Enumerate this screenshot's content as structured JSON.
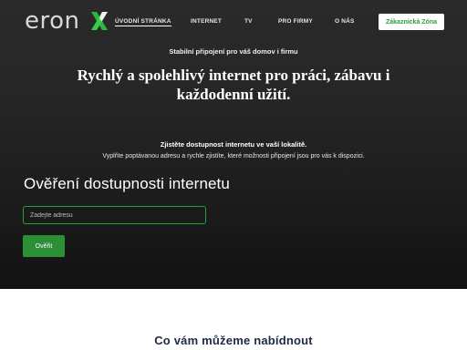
{
  "header": {
    "logo_text": "eron",
    "logo_icon": "green-x-icon",
    "nav": [
      {
        "label": "ÚVODNÍ STRÁNKA",
        "active": true
      },
      {
        "label": "INTERNET",
        "active": false
      },
      {
        "label": "TV",
        "active": false
      },
      {
        "label": "PRO FIRMY",
        "active": false
      },
      {
        "label": "O NÁS",
        "active": false
      }
    ],
    "zone_button": "Zákaznická Zóna"
  },
  "hero": {
    "tagline": "Stabilní připojení pro váš domov i firmu",
    "headline": "Rychlý a spolehlivý internet pro práci, zábavu i každodenní užití.",
    "check_title": "Zjistěte dostupnost internetu ve vaší lokalitě.",
    "check_desc": "Vyplňte poptávanou adresu a rychle zjistíte, které možnosti připojení jsou pro vás k dispozici."
  },
  "availability": {
    "title": "Ověření dostupnosti internetu",
    "address_placeholder": "Zadejte adresu",
    "address_value": "",
    "submit_label": "Ověřit"
  },
  "offer": {
    "title": "Co vám můžeme nabídnout"
  },
  "colors": {
    "accent_green": "#2a9d36",
    "hero_dark": "#1c1c1c",
    "offer_title": "#1d2a44"
  }
}
